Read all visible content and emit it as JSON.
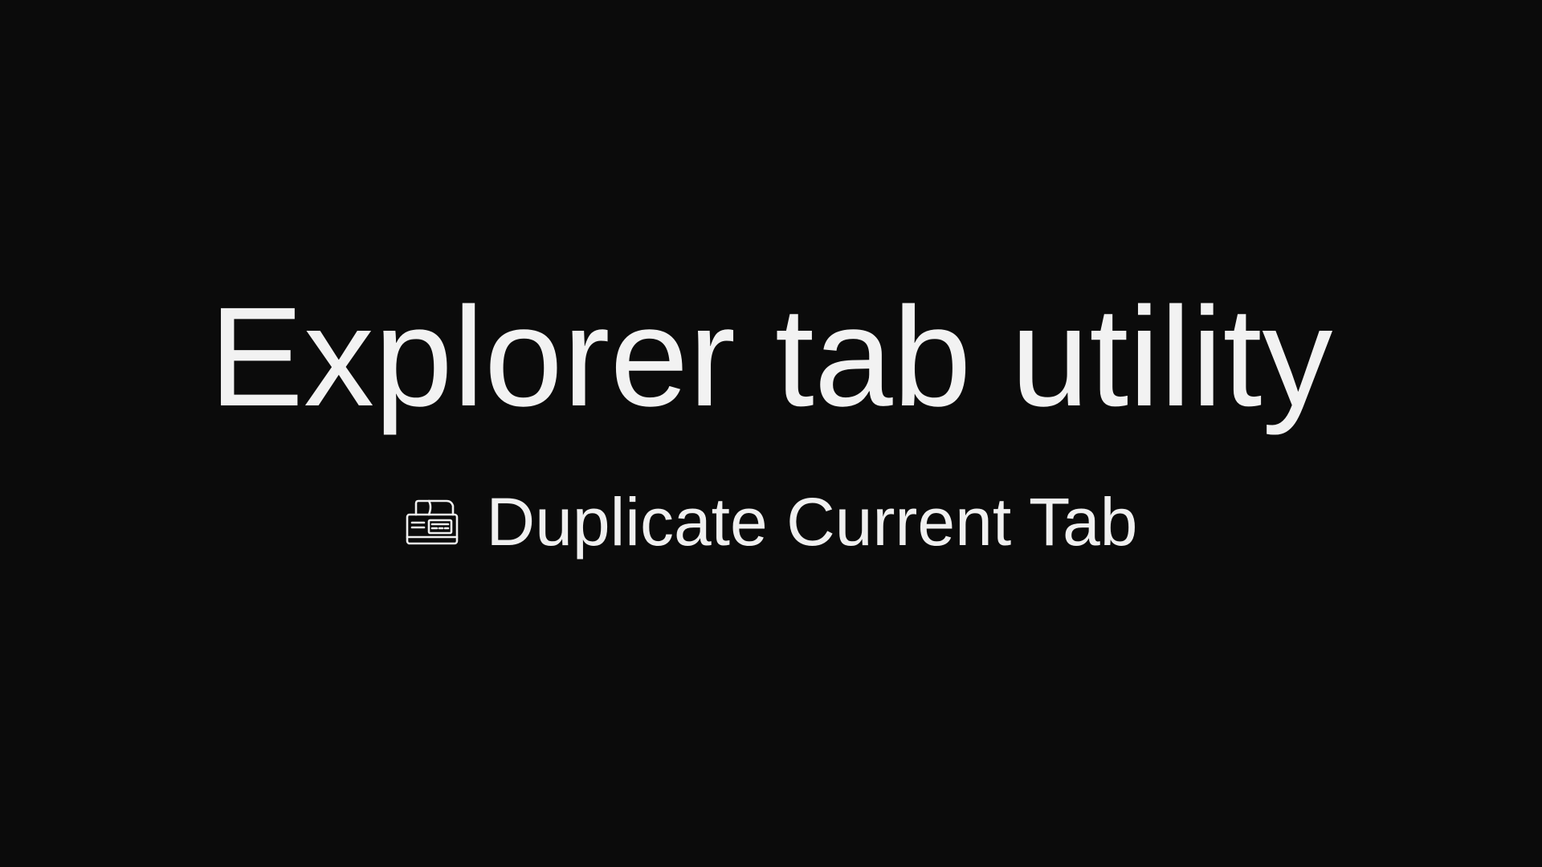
{
  "title": "Explorer tab utility",
  "action": {
    "label": "Duplicate Current Tab",
    "icon": "fax-machine-icon"
  },
  "colors": {
    "background": "#0b0b0b",
    "text": "#f2f2f2"
  }
}
